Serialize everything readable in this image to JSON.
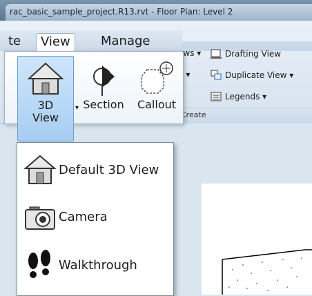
{
  "window": {
    "title": "rac_basic_sample_project.R13.rvt - Floor Plan: Level 2"
  },
  "ribbon": {
    "tabs": [
      {
        "label": "te",
        "active": false
      },
      {
        "label": "View",
        "active": true
      },
      {
        "label": "Manage",
        "active": false
      }
    ],
    "buttons": [
      {
        "line1": "3D",
        "line2": "View",
        "arrow": "▾",
        "icon": "house-icon",
        "pressed": true
      },
      {
        "line1": "Section",
        "icon": "section-icon"
      },
      {
        "line1": "Callout",
        "icon": "callout-icon"
      }
    ],
    "right_items": {
      "views_fragment": "ews ▾",
      "n_fragment": "n ▾",
      "drafting_view": "Drafting View",
      "duplicate_view": "Duplicate View ▾",
      "legends": "Legends ▾"
    },
    "panel_label": "Create"
  },
  "dropdown": {
    "items": [
      {
        "label": "Default 3D View",
        "icon": "house-icon"
      },
      {
        "label": "Camera",
        "icon": "camera-icon"
      },
      {
        "label": "Walkthrough",
        "icon": "footprints-icon"
      }
    ]
  }
}
